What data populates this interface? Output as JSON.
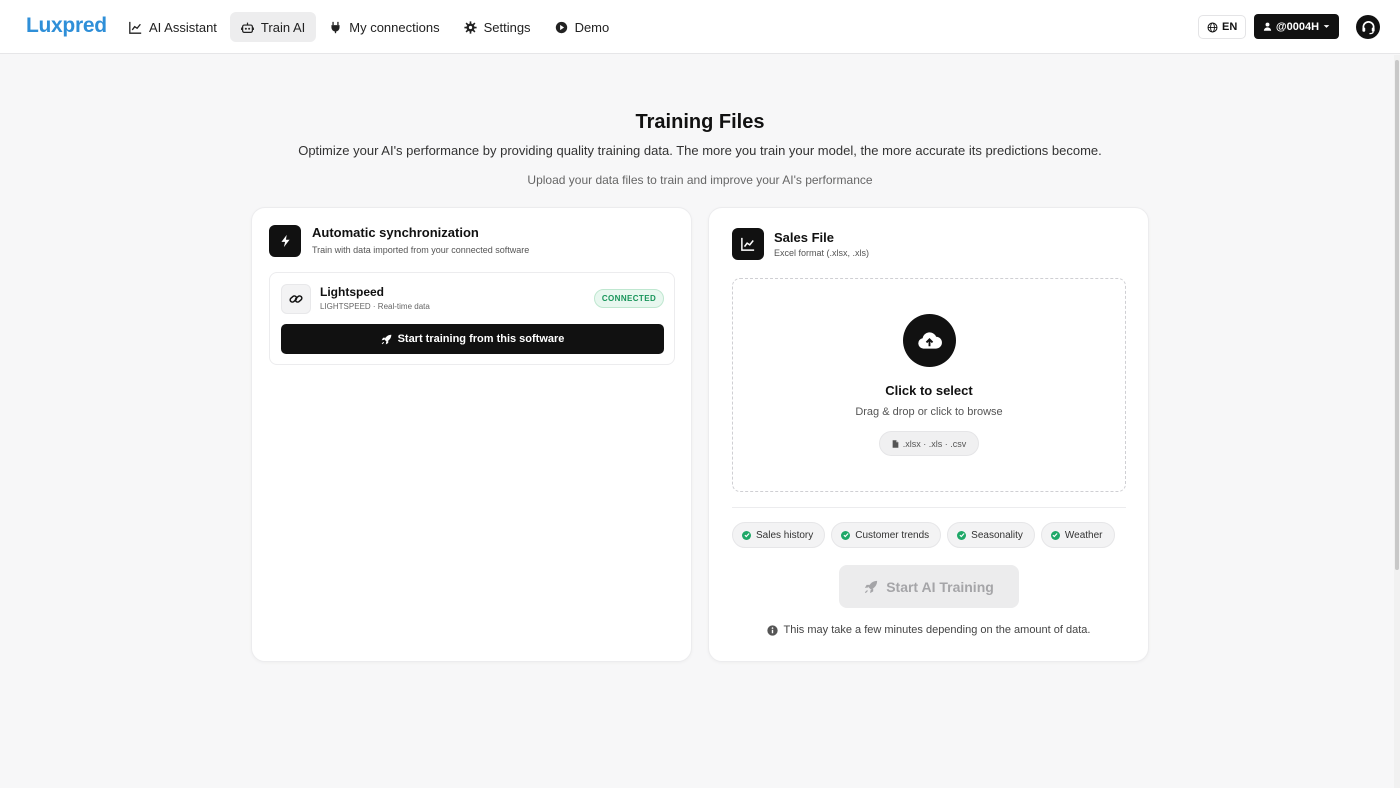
{
  "header": {
    "logo": "Luxpred",
    "nav": [
      {
        "label": "AI Assistant",
        "icon": "chart-line-icon"
      },
      {
        "label": "Train AI",
        "icon": "robot-icon",
        "active": true
      },
      {
        "label": "My connections",
        "icon": "plug-icon"
      },
      {
        "label": "Settings",
        "icon": "gear-icon"
      },
      {
        "label": "Demo",
        "icon": "play-circle-icon"
      }
    ],
    "language": "EN",
    "user": "@0004H"
  },
  "page": {
    "title": "Training Files",
    "subtitle": "Optimize your AI's performance by providing quality training data. The more you train your model, the more accurate its predictions become.",
    "hint": "Upload your data files to train and improve your AI's performance"
  },
  "sync_card": {
    "title": "Automatic synchronization",
    "subtitle": "Train with data imported from your connected software",
    "connection": {
      "name": "Lightspeed",
      "meta": "LIGHTSPEED · Real-time data",
      "status": "CONNECTED",
      "button": "Start training from this software"
    }
  },
  "sales_card": {
    "title": "Sales File",
    "subtitle": "Excel format (.xlsx, .xls)",
    "dropzone": {
      "title": "Click to select",
      "subtitle": "Drag & drop or click to browse",
      "formats": ".xlsx · .xls · .csv"
    },
    "tags": [
      "Sales history",
      "Customer trends",
      "Seasonality",
      "Weather"
    ],
    "start_button": "Start AI Training",
    "note": "This may take a few minutes depending on the amount of data."
  },
  "colors": {
    "brand": "#2f8fd8",
    "dark": "#111111",
    "success": "#1fa868",
    "disabled_bg": "#ececed"
  }
}
